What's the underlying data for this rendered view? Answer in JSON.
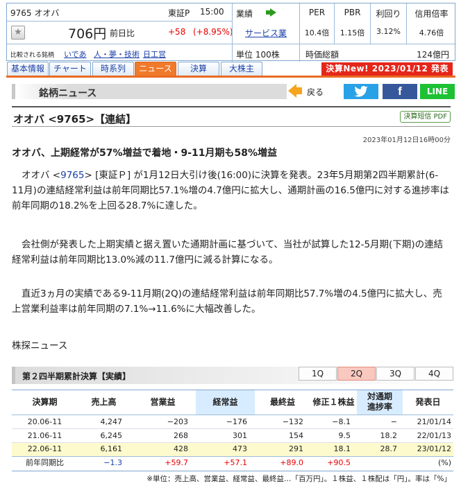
{
  "header": {
    "code_name": "9765 オオバ",
    "market": "東証P",
    "time": "15:00",
    "price": "706円",
    "prev_label": "前日比",
    "change": "+58",
    "change_pct": "(+8.95%)",
    "compare_label": "比較される銘柄",
    "compare_links": [
      "いであ",
      "人・夢・技術",
      "日工営"
    ],
    "gyoseki_label": "業績",
    "sector": "サービス業",
    "unit": "単位 100株",
    "per_label": "PER",
    "per": "10.4倍",
    "pbr_label": "PBR",
    "pbr": "1.15倍",
    "yield_label": "利回り",
    "yield": "3.12%",
    "margin_label": "信用倍率",
    "margin": "4.76倍",
    "cap_label": "時価総額",
    "cap": "124億円"
  },
  "tabs": [
    {
      "label": "基本情報",
      "active": false
    },
    {
      "label": "チャート",
      "active": false
    },
    {
      "label": "時系列",
      "active": false
    },
    {
      "label": "ニュース",
      "active": true
    },
    {
      "label": "決算",
      "active": false
    },
    {
      "label": "大株主",
      "active": false
    }
  ],
  "tab_badge": "決算New! 2023/01/12 発表",
  "section_title": "銘柄ニュース",
  "back_label": "戻る",
  "share": {
    "facebook": "f",
    "line": "LINE"
  },
  "article": {
    "company_title": "オオバ <9765>【連結】",
    "pdf_label": "決算短信 PDF",
    "timestamp": "2023年01月12日16時00分",
    "headline": "オオバ、上期経常が57%増益で着地・9-11月期も58%増益",
    "p1_pre": "オオバ <",
    "p1_code": "9765",
    "p1_post": "> [東証Ｐ] が1月12日大引け後(16:00)に決算を発表。23年5月期第2四半期累計(6-11月)の連結経常利益は前年同期比57.1%増の4.7億円に拡大し、通期計画の16.5億円に対する進捗率は前年同期の18.2%を上回る28.7%に達した。",
    "p2": "会社側が発表した上期実績と据え置いた通期計画に基づいて、当社が試算した12-5月期(下期)の連結経常利益は前年同期比13.0%減の11.7億円に減る計算になる。",
    "p3": "直近3ヵ月の実績である9-11月期(2Q)の連結経常利益は前年同期比57.7%増の4.5億円に拡大し、売上営業利益率は前年同期の7.1%→11.6%に大幅改善した。",
    "source": "株探ニュース"
  },
  "results": {
    "title": "第２四半期累計決算【実績】",
    "quarters": [
      "1Q",
      "2Q",
      "3Q",
      "4Q"
    ],
    "active_quarter": "2Q",
    "columns": [
      "決算期",
      "売上高",
      "営業益",
      "経常益",
      "最終益",
      "修正１株益",
      "対通期進捗率",
      "発表日"
    ],
    "progress_col_l1": "対通期",
    "progress_col_l2": "進捗率",
    "rows": [
      [
        "20.06-11",
        "4,247",
        "−203",
        "−176",
        "−132",
        "−8.1",
        "−",
        "21/01/14"
      ],
      [
        "21.06-11",
        "6,245",
        "268",
        "301",
        "154",
        "9.5",
        "18.2",
        "22/01/13"
      ],
      [
        "22.06-11",
        "6,161",
        "428",
        "473",
        "291",
        "18.1",
        "28.7",
        "23/01/12"
      ]
    ],
    "yoy": [
      "前年同期比",
      "−1.3",
      "+59.7",
      "+57.1",
      "+89.0",
      "+90.5",
      "",
      "(%)"
    ],
    "footnote": "※単位：売上高、営業益、経常益、最終益…「百万円」。１株益、１株配は「円」。率は「%」"
  }
}
